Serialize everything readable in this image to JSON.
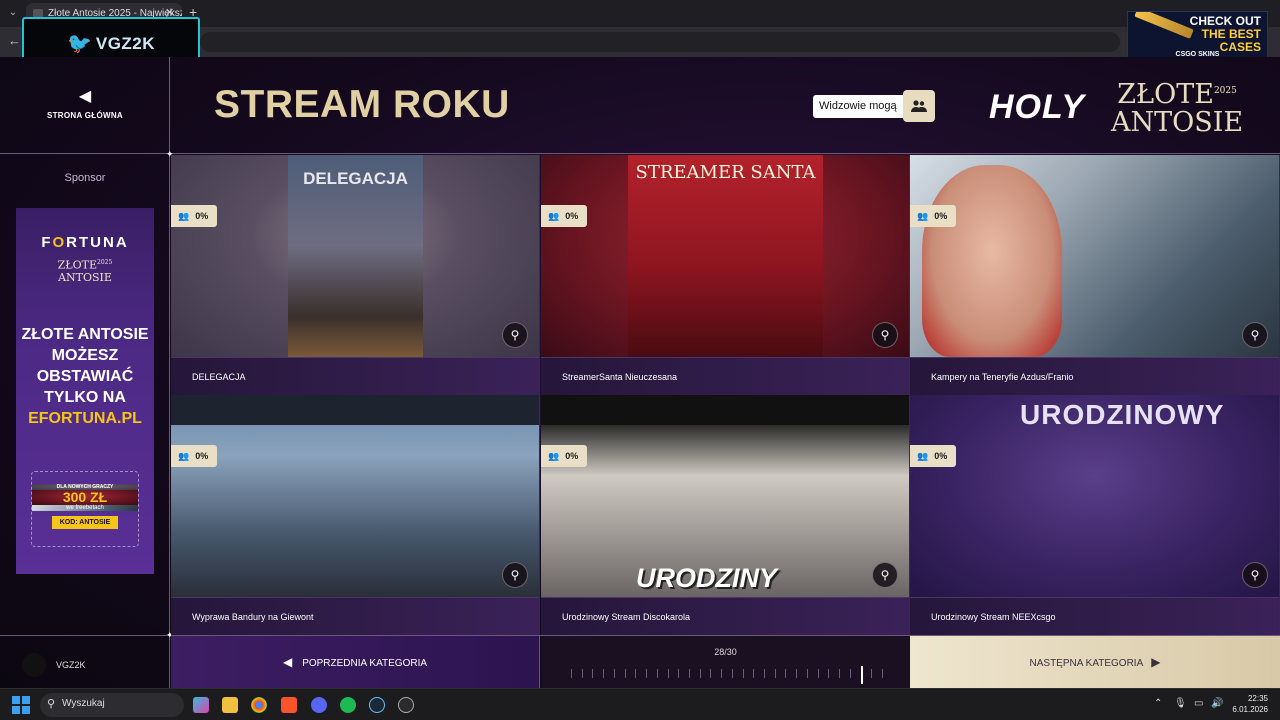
{
  "browser": {
    "tab_title": "Złote Antosie 2025 - Największ",
    "tab_close": "✕",
    "new_tab": "+"
  },
  "overlays": {
    "streamer_badge": "VGZ2K",
    "ad_line1": "CHECK OUT",
    "ad_line2": "THE BEST",
    "ad_line3": "CASES",
    "ad_brand": "CSGO SKINS"
  },
  "nav": {
    "home_label": "STRONA GŁÓWNA"
  },
  "sponsor": {
    "label": "Sponsor",
    "brand_prefix": "F",
    "brand_o": "O",
    "brand_suffix": "RTUNA",
    "event_line1": "ZŁOTE",
    "event_year": "2025",
    "event_line2": "ANTOSIE",
    "pitch_line1": "ZŁOTE ANTOSIE",
    "pitch_line2": "MOŻESZ",
    "pitch_line3": "OBSTAWIAĆ",
    "pitch_line4": "TYLKO NA",
    "pitch_domain": "EFORTUNA.PL",
    "bonus_intro": "DLA NOWYCH GRACZY",
    "bonus_amount": "300 ZŁ",
    "bonus_desc": "we freebetach",
    "bonus_code": "KOD: ANTOSIE"
  },
  "user": {
    "name": "VGZ2K"
  },
  "header": {
    "category_title": "STREAM ROKU",
    "visibility_label": "Widzowie mogą",
    "logo_holy": "HOLY",
    "logo_line1": "ZŁOTE",
    "logo_year": "2025",
    "logo_line2": "ANTOSIE"
  },
  "nominees": [
    {
      "title": "DELEGACJA",
      "percent": "0%",
      "poster_text": "DELEGACJA"
    },
    {
      "title": "StreamerSanta Nieucze­sana",
      "percent": "0%",
      "poster_text": "STREAMER SANTA"
    },
    {
      "title": "Kampery na Teneryfie Azdus/Franio",
      "percent": "0%"
    },
    {
      "title": "Wyprawa Bandury na Giewont",
      "percent": "0%"
    },
    {
      "title": "Urodzinowy Stream Discokarola",
      "percent": "0%",
      "poster_text": "URODZINY"
    },
    {
      "title": "Urodzinowy Stream NEEXcsgo",
      "percent": "0%",
      "poster_text": "URODZINOWY"
    }
  ],
  "footer": {
    "prev_label": "POPRZEDNIA KATEGORIA",
    "progress_text": "28/30",
    "progress_current": 28,
    "progress_total": 30,
    "next_label": "NASTĘPNA KATEGORIA"
  },
  "taskbar": {
    "search_placeholder": "Wyszukaj",
    "time": "22:35",
    "date": "6.01.2026"
  },
  "colors": {
    "accent_gold": "#e1d0a4",
    "badge_bg": "#e9dfc6",
    "fortuna_yellow": "#f5c518"
  }
}
